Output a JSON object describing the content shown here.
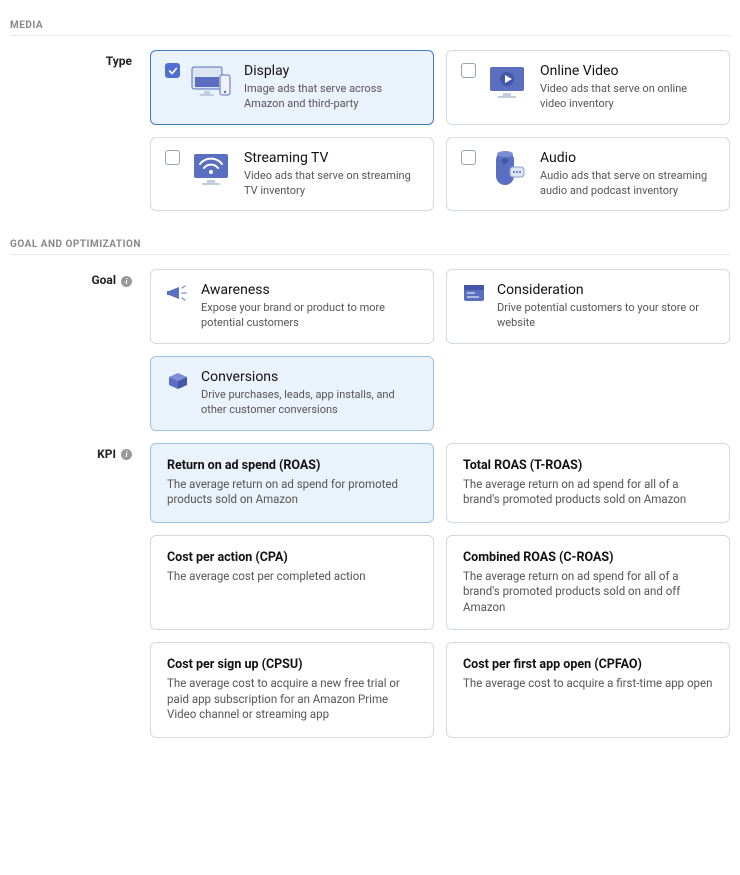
{
  "section_media": "MEDIA",
  "section_goal": "GOAL AND OPTIMIZATION",
  "label_type": "Type",
  "label_goal": "Goal",
  "label_kpi": "KPI",
  "media": {
    "display": {
      "title": "Display",
      "desc": "Image ads that serve across Amazon and third-party"
    },
    "video": {
      "title": "Online Video",
      "desc": "Video ads that serve on online video inventory"
    },
    "streaming": {
      "title": "Streaming TV",
      "desc": "Video ads that serve on streaming TV inventory"
    },
    "audio": {
      "title": "Audio",
      "desc": "Audio ads that serve on streaming audio and podcast inventory"
    }
  },
  "goal": {
    "awareness": {
      "title": "Awareness",
      "desc": "Expose your brand or product to more potential customers"
    },
    "consideration": {
      "title": "Consideration",
      "desc": "Drive potential customers to your store or website"
    },
    "conversions": {
      "title": "Conversions",
      "desc": "Drive purchases, leads, app installs, and other customer conversions"
    }
  },
  "kpi": {
    "roas": {
      "title": "Return on ad spend (ROAS)",
      "desc": "The average return on ad spend for promoted products sold on Amazon"
    },
    "troas": {
      "title": "Total ROAS (T-ROAS)",
      "desc": "The average return on ad spend for all of a brand's promoted products sold on Amazon"
    },
    "cpa": {
      "title": "Cost per action (CPA)",
      "desc": "The average cost per completed action"
    },
    "croas": {
      "title": "Combined ROAS (C-ROAS)",
      "desc": "The average return on ad spend for all of a brand's promoted products sold on and off Amazon"
    },
    "cpsu": {
      "title": "Cost per sign up (CPSU)",
      "desc": "The average cost to acquire a new free trial or paid app subscription for an Amazon Prime Video channel or streaming app"
    },
    "cpfao": {
      "title": "Cost per first app open (CPFAO)",
      "desc": "The average cost to acquire a first-time app open"
    }
  }
}
